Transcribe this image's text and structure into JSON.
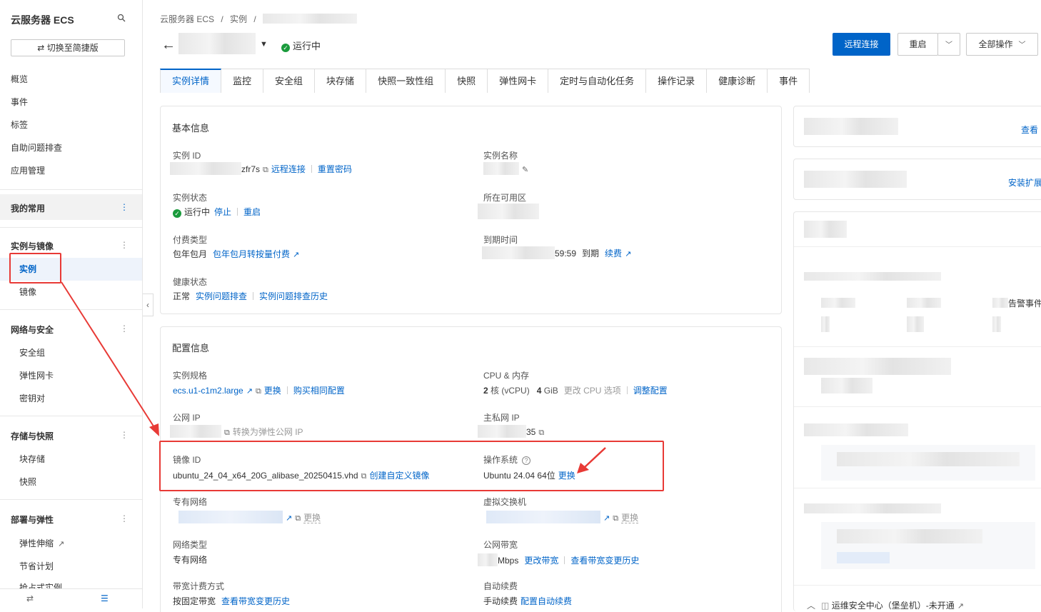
{
  "sidebar": {
    "title": "云服务器 ECS",
    "switch_label": "切换至简捷版",
    "items": [
      "概览",
      "事件",
      "标签",
      "自助问题排查",
      "应用管理"
    ],
    "fav_group": "我的常用",
    "groups": [
      {
        "label": "实例与镜像",
        "items": [
          "实例",
          "镜像"
        ]
      },
      {
        "label": "网络与安全",
        "items": [
          "安全组",
          "弹性网卡",
          "密钥对"
        ]
      },
      {
        "label": "存储与快照",
        "items": [
          "块存储",
          "快照"
        ]
      },
      {
        "label": "部署与弹性",
        "items": [
          "弹性伸缩",
          "节省计划",
          "抢占式实例"
        ]
      }
    ],
    "collapse_icon": "‹"
  },
  "breadcrumb": {
    "a": "云服务器 ECS",
    "sep": "/",
    "b": "实例",
    "sep2": "/"
  },
  "header": {
    "status": "运行中",
    "btn_remote": "远程连接",
    "btn_restart": "重启",
    "btn_all": "全部操作"
  },
  "tabs": [
    "实例详情",
    "监控",
    "安全组",
    "块存储",
    "快照一致性组",
    "快照",
    "弹性网卡",
    "定时与自动化任务",
    "操作记录",
    "健康诊断",
    "事件"
  ],
  "basic": {
    "title": "基本信息",
    "instance_id_label": "实例 ID",
    "instance_id_suffix": "zfr7s",
    "remote_link": "远程连接",
    "reset_pwd": "重置密码",
    "instance_name_label": "实例名称",
    "status_label": "实例状态",
    "status_value": "运行中",
    "stop_link": "停止",
    "restart_link": "重启",
    "zone_label": "所在可用区",
    "billing_label": "付费类型",
    "billing_value": "包年包月",
    "billing_link": "包年包月转按量付费",
    "expire_label": "到期时间",
    "expire_suffix": "59:59",
    "expire_state": "到期",
    "renew_link": "续费",
    "health_label": "健康状态",
    "health_value": "正常",
    "health_link1": "实例问题排查",
    "health_link2": "实例问题排查历史"
  },
  "config": {
    "title": "配置信息",
    "spec_label": "实例规格",
    "spec_value": "ecs.u1-c1m2.large",
    "spec_change": "更换",
    "spec_buy": "购买相同配置",
    "cpu_label": "CPU & 内存",
    "cpu_num": "2",
    "cpu_unit": "核  (vCPU)",
    "mem_num": "4",
    "mem_unit": "GiB",
    "cpu_option": "更改 CPU 选项",
    "cpu_adjust": "调整配置",
    "pub_ip_label": "公网 IP",
    "pub_ip_convert": "转换为弹性公网 IP",
    "priv_ip_label": "主私网 IP",
    "priv_ip_suffix": "35",
    "image_label": "镜像 ID",
    "image_value": "ubuntu_24_04_x64_20G_alibase_20250415.vhd",
    "image_link": "创建自定义镜像",
    "os_label": "操作系统",
    "os_value": "Ubuntu 24.04 64位",
    "os_change": "更换",
    "vpc_label": "专有网络",
    "vpc_change": "更换",
    "vsw_label": "虚拟交换机",
    "vsw_change": "更换",
    "net_type_label": "网络类型",
    "net_type_value": "专有网络",
    "bw_label": "公网带宽",
    "bw_suffix": "Mbps",
    "bw_change": "更改带宽",
    "bw_history": "查看带宽变更历史",
    "bw_billing_label": "带宽计费方式",
    "bw_billing_value": "按固定带宽",
    "bw_billing_history": "查看带宽变更历史",
    "auto_renew_label": "自动续费",
    "auto_renew_value": "手动续费",
    "auto_renew_link": "配置自动续费"
  },
  "right": {
    "view_link": "查看",
    "install_link": "安装扩展",
    "alert_text": "告警事件",
    "bastion": "运维安全中心（堡垒机）-未开通"
  },
  "colors": {
    "primary": "#0064c8",
    "highlight": "#e83a36",
    "ok": "#1a9b3c"
  }
}
